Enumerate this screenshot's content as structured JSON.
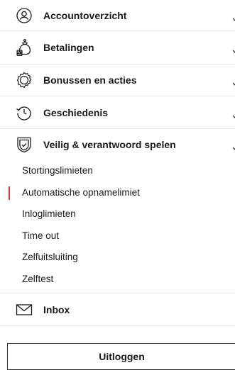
{
  "menu": {
    "items": [
      {
        "label": "Accountoverzicht",
        "icon": "user-circle-icon"
      },
      {
        "label": "Betalingen",
        "icon": "money-bag-icon"
      },
      {
        "label": "Bonussen en acties",
        "icon": "gift-badge-icon"
      },
      {
        "label": "Geschiedenis",
        "icon": "history-clock-icon"
      },
      {
        "label": "Veilig & verantwoord spelen",
        "icon": "shield-check-icon"
      }
    ],
    "responsible_gaming_subitems": [
      {
        "label": "Stortingslimieten"
      },
      {
        "label": "Automatische opnamelimiet",
        "active": true
      },
      {
        "label": "Inloglimieten"
      },
      {
        "label": "Time out"
      },
      {
        "label": "Zelfuitsluiting"
      },
      {
        "label": "Zelftest"
      }
    ],
    "inbox": {
      "label": "Inbox",
      "icon": "envelope-icon"
    }
  },
  "logout": {
    "label": "Uitloggen"
  },
  "colors": {
    "active_indicator": "#d6333f",
    "divider": "#e6e6e6",
    "text": "#1a1a1a"
  }
}
